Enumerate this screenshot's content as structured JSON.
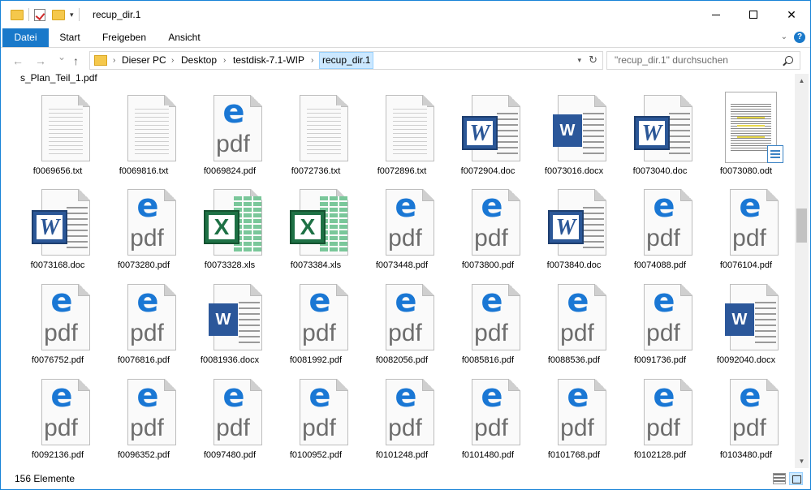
{
  "window": {
    "title": "recup_dir.1",
    "minimize_icon": "minimize-icon",
    "maximize_icon": "maximize-icon",
    "close_symbol": "✕"
  },
  "ribbon": {
    "tabs": [
      {
        "label": "Datei"
      },
      {
        "label": "Start"
      },
      {
        "label": "Freigeben"
      },
      {
        "label": "Ansicht"
      }
    ],
    "help": "?"
  },
  "nav": {
    "back": "←",
    "forward": "→",
    "recent": "⌄",
    "up": "↑",
    "breadcrumbs": [
      "Dieser PC",
      "Desktop",
      "testdisk-7.1-WIP",
      "recup_dir.1"
    ],
    "separator": "›",
    "search_placeholder": "\"recup_dir.1\" durchsuchen"
  },
  "content": {
    "partial_label": "s_Plan_Teil_1.pdf",
    "files": [
      {
        "name": "f0069656.txt",
        "type": "txt"
      },
      {
        "name": "f0069816.txt",
        "type": "txt"
      },
      {
        "name": "f0069824.pdf",
        "type": "pdf"
      },
      {
        "name": "f0072736.txt",
        "type": "txt"
      },
      {
        "name": "f0072896.txt",
        "type": "txt"
      },
      {
        "name": "f0072904.doc",
        "type": "doc"
      },
      {
        "name": "f0073016.docx",
        "type": "docx"
      },
      {
        "name": "f0073040.doc",
        "type": "doc"
      },
      {
        "name": "f0073080.odt",
        "type": "odt"
      },
      {
        "name": "f0073168.doc",
        "type": "doc"
      },
      {
        "name": "f0073280.pdf",
        "type": "pdf"
      },
      {
        "name": "f0073328.xls",
        "type": "xls"
      },
      {
        "name": "f0073384.xls",
        "type": "xls"
      },
      {
        "name": "f0073448.pdf",
        "type": "pdf"
      },
      {
        "name": "f0073800.pdf",
        "type": "pdf"
      },
      {
        "name": "f0073840.doc",
        "type": "doc"
      },
      {
        "name": "f0074088.pdf",
        "type": "pdf"
      },
      {
        "name": "f0076104.pdf",
        "type": "pdf"
      },
      {
        "name": "f0076752.pdf",
        "type": "pdf"
      },
      {
        "name": "f0076816.pdf",
        "type": "pdf"
      },
      {
        "name": "f0081936.docx",
        "type": "docx"
      },
      {
        "name": "f0081992.pdf",
        "type": "pdf"
      },
      {
        "name": "f0082056.pdf",
        "type": "pdf"
      },
      {
        "name": "f0085816.pdf",
        "type": "pdf"
      },
      {
        "name": "f0088536.pdf",
        "type": "pdf"
      },
      {
        "name": "f0091736.pdf",
        "type": "pdf"
      },
      {
        "name": "f0092040.docx",
        "type": "docx"
      },
      {
        "name": "f0092136.pdf",
        "type": "pdf"
      },
      {
        "name": "f0096352.pdf",
        "type": "pdf"
      },
      {
        "name": "f0097480.pdf",
        "type": "pdf"
      },
      {
        "name": "f0100952.pdf",
        "type": "pdf"
      },
      {
        "name": "f0101248.pdf",
        "type": "pdf"
      },
      {
        "name": "f0101480.pdf",
        "type": "pdf"
      },
      {
        "name": "f0101768.pdf",
        "type": "pdf"
      },
      {
        "name": "f0102128.pdf",
        "type": "pdf"
      },
      {
        "name": "f0103480.pdf",
        "type": "pdf"
      }
    ]
  },
  "status": {
    "count": "156 Elemente"
  },
  "icon_text": {
    "pdf": "pdf",
    "word_new": "W"
  },
  "colors": {
    "accent": "#1979ca",
    "pdf_blue": "#1a77d4",
    "word_blue": "#2b579a",
    "excel_green": "#1e7145",
    "folder_yellow": "#f5c84c"
  }
}
